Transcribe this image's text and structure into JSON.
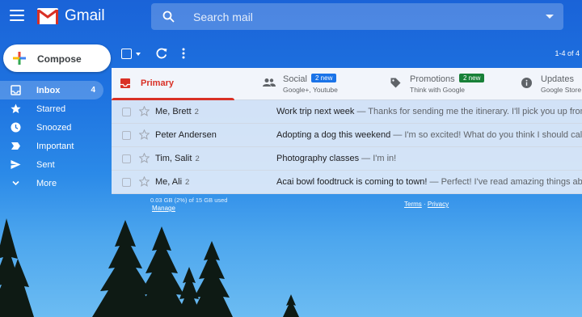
{
  "header": {
    "app_name": "Gmail",
    "search_placeholder": "Search mail"
  },
  "compose": {
    "label": "Compose"
  },
  "sidebar": {
    "items": [
      {
        "label": "Inbox",
        "count": "4",
        "icon": "inbox-icon"
      },
      {
        "label": "Starred",
        "count": "",
        "icon": "star-icon"
      },
      {
        "label": "Snoozed",
        "count": "",
        "icon": "clock-icon"
      },
      {
        "label": "Important",
        "count": "",
        "icon": "important-icon"
      },
      {
        "label": "Sent",
        "count": "",
        "icon": "send-icon"
      },
      {
        "label": "More",
        "count": "",
        "icon": "chevron-down-icon"
      }
    ]
  },
  "toolbar": {
    "pagination": "1-4 of 4"
  },
  "tabs": [
    {
      "name": "Primary",
      "sub": "",
      "badge": ""
    },
    {
      "name": "Social",
      "sub": "Google+, Youtube",
      "badge": "2 new",
      "badge_color": "#1a73e8"
    },
    {
      "name": "Promotions",
      "sub": "Think with Google",
      "badge": "2 new",
      "badge_color": "#188038"
    },
    {
      "name": "Updates",
      "sub": "Google Store",
      "badge": ""
    }
  ],
  "emails": [
    {
      "sender": "Me, Brett",
      "count": "2",
      "subject": "Work trip next week",
      "snippet": " — Thanks for sending me the itinerary. I'll pick you up from the"
    },
    {
      "sender": "Peter Andersen",
      "count": "",
      "subject": "Adopting a dog this weekend",
      "snippet": " — I'm so excited! What do you think I should call it? :)"
    },
    {
      "sender": "Tim, Salit",
      "count": "2",
      "subject": "Photography classes",
      "snippet": " — I'm in!"
    },
    {
      "sender": "Me, Ali",
      "count": "2",
      "subject": "Acai bowl foodtruck is coming to town!",
      "snippet": " — Perfect! I've read amazing things about t"
    }
  ],
  "footer": {
    "storage": "0.03 GB (2%) of 15 GB used",
    "manage": "Manage",
    "terms": "Terms",
    "separator": " · ",
    "privacy": "Privacy"
  },
  "colors": {
    "accent_red": "#d93025",
    "background_blue": "#1e73e0"
  }
}
